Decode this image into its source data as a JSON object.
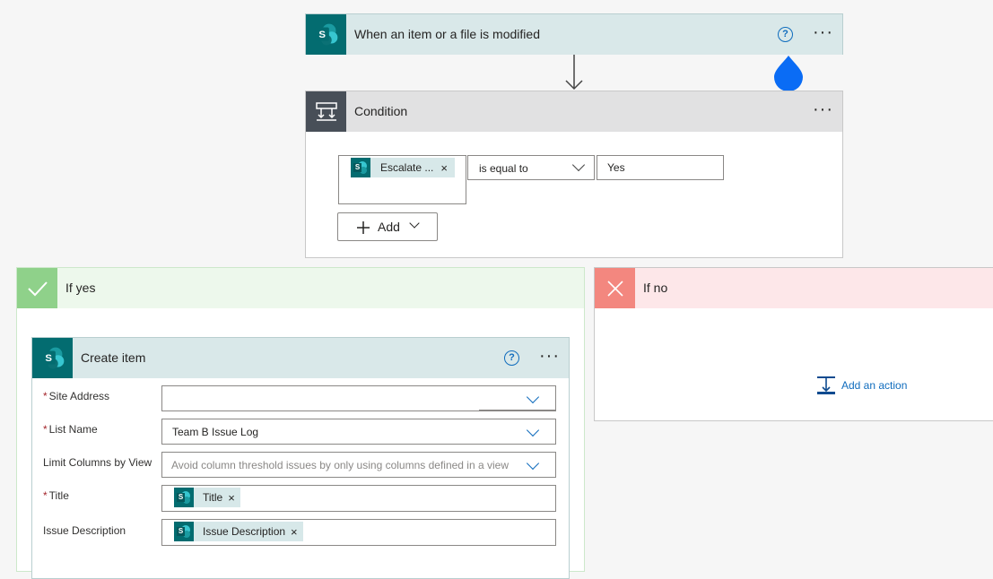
{
  "trigger": {
    "title": "When an item or a file is modified",
    "help": "?",
    "more": "···"
  },
  "condition": {
    "title": "Condition",
    "more": "···",
    "token_label": "Escalate ...",
    "token_remove": "×",
    "operator": "is equal to",
    "value": "Yes",
    "add_label": "Add"
  },
  "if_yes": {
    "title": "If yes"
  },
  "if_no": {
    "title": "If no",
    "add_action": "Add an action"
  },
  "create_item": {
    "title": "Create item",
    "help": "?",
    "more": "···",
    "fields": {
      "site_address": {
        "label": "Site Address",
        "value": ""
      },
      "list_name": {
        "label": "List Name",
        "value": "Team B Issue Log"
      },
      "limit_columns": {
        "label": "Limit Columns by View",
        "placeholder": "Avoid column threshold issues by only using columns defined in a view"
      },
      "title": {
        "label": "Title",
        "token": "Title",
        "remove": "×"
      },
      "issue_description": {
        "label": "Issue Description",
        "token": "Issue Description",
        "remove": "×"
      }
    },
    "required_mark": "*"
  },
  "colors": {
    "sharepoint_header": "#d9e8e9",
    "sharepoint_icon": "#036c70",
    "condition_header": "#e1e1e2",
    "condition_icon": "#484f58",
    "yes_header": "#edf8ec",
    "yes_icon": "#8fd18a",
    "no_header": "#fde7e9",
    "no_icon": "#f3877f",
    "accent": "#0f6cbd",
    "drop_pin": "#0a6cf5"
  },
  "icons": [
    "sharepoint-icon",
    "condition-icon",
    "check-icon",
    "close-icon",
    "add-action-icon",
    "help-icon",
    "more-icon",
    "chevron-down-icon",
    "plus-icon",
    "arrow-down-icon",
    "drop-pin-icon"
  ]
}
